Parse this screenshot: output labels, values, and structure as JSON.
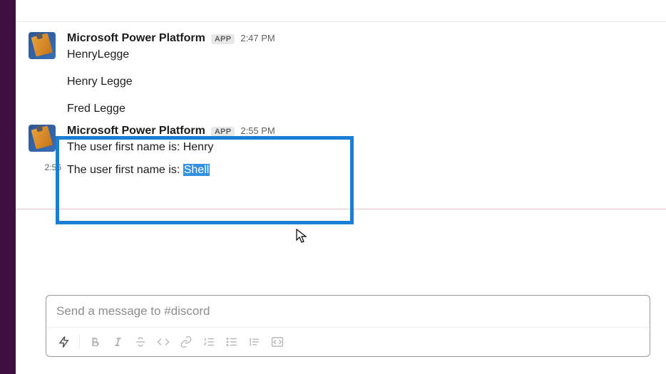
{
  "messages": [
    {
      "sender": "Microsoft Power Platform",
      "badge": "APP",
      "time": "2:47 PM",
      "lines": [
        "HenryLegge",
        "Henry Legge",
        "Fred Legge"
      ]
    },
    {
      "sender": "Microsoft Power Platform",
      "badge": "APP",
      "time": "2:55 PM",
      "line": "The user first name is: Henry",
      "cont_time": "2:56",
      "cont_prefix": "The user first name is: ",
      "cont_selected": "Shell"
    }
  ],
  "composer": {
    "placeholder": "Send a message to #discord"
  }
}
